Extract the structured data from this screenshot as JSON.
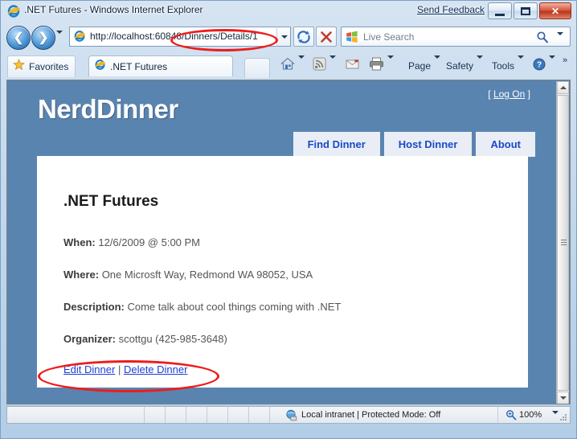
{
  "window": {
    "title": ".NET Futures - Windows Internet Explorer",
    "send_feedback": "Send Feedback",
    "minimize_label": "Minimize",
    "maximize_label": "Maximize",
    "close_label": "Close"
  },
  "navbar": {
    "back_label": "Back",
    "forward_label": "Forward",
    "url": "http://localhost:60848/Dinners/Details/1",
    "refresh_label": "Refresh",
    "stop_label": "Stop",
    "search_placeholder": "Live Search"
  },
  "toolbar": {
    "favorites_label": "Favorites",
    "tab_title": ".NET Futures",
    "new_tab_label": "New Tab",
    "commands": [
      {
        "label": "Page"
      },
      {
        "label": "Safety"
      },
      {
        "label": "Tools"
      }
    ],
    "overflow": "»"
  },
  "page": {
    "logo": "NerdDinner",
    "login_open_bracket": "[",
    "login_link": "Log On",
    "login_close_bracket": "]",
    "menu": [
      {
        "label": "Find Dinner"
      },
      {
        "label": "Host Dinner"
      },
      {
        "label": "About"
      }
    ],
    "dinner": {
      "title": ".NET Futures",
      "when_label": "When:",
      "when_value": "12/6/2009 @ 5:00 PM",
      "where_label": "Where:",
      "where_value": "One Microsft Way, Redmond WA 98052, USA",
      "description_label": "Description:",
      "description_value": "Come talk about cool things coming with .NET",
      "organizer_label": "Organizer:",
      "organizer_value": "scottgu (425-985-3648)",
      "edit_link": "Edit Dinner",
      "link_separator": "|",
      "delete_link": "Delete Dinner"
    }
  },
  "statusbar": {
    "zone": "Local intranet | Protected Mode: Off",
    "zoom": "100%"
  },
  "colors": {
    "page_background": "#5a84b0",
    "menu_background": "#e9eef6",
    "menu_text": "#1b48c8",
    "link": "#1b3fd4",
    "annotation": "#ee1c1c",
    "content_background": "#ffffff"
  }
}
